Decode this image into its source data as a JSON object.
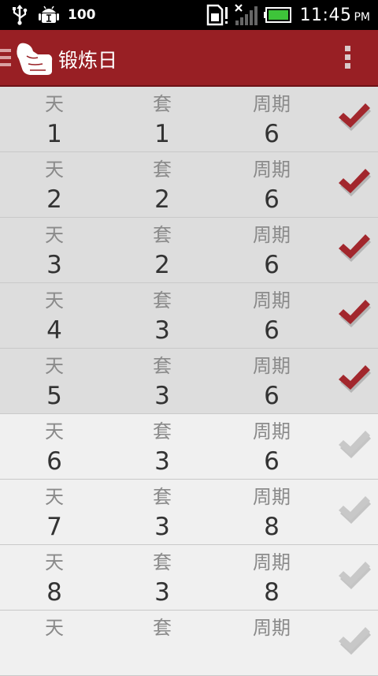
{
  "status_bar": {
    "battery_percent": "100",
    "time": "11:45",
    "ampm": "PM",
    "icons": [
      "usb-icon",
      "android-debug-icon",
      "sim-card-icon",
      "signal-icon",
      "battery-icon"
    ]
  },
  "action_bar": {
    "title": "锻炼日",
    "icons": [
      "up-indicator-icon",
      "app-logo-icon",
      "overflow-menu-icon"
    ]
  },
  "colors": {
    "action_bar": "#981f24",
    "check_done": "#a2272d",
    "check_pending": "#c8c8c8",
    "row_done_bg": "#dddddd",
    "row_todo_bg": "#f0f0f0"
  },
  "list": {
    "headers": [
      "天",
      "套",
      "周期"
    ],
    "rows": [
      {
        "day": "1",
        "sets": "1",
        "cycle": "6",
        "completed": true
      },
      {
        "day": "2",
        "sets": "2",
        "cycle": "6",
        "completed": true
      },
      {
        "day": "3",
        "sets": "2",
        "cycle": "6",
        "completed": true
      },
      {
        "day": "4",
        "sets": "3",
        "cycle": "6",
        "completed": true
      },
      {
        "day": "5",
        "sets": "3",
        "cycle": "6",
        "completed": true
      },
      {
        "day": "6",
        "sets": "3",
        "cycle": "6",
        "completed": false
      },
      {
        "day": "7",
        "sets": "3",
        "cycle": "8",
        "completed": false
      },
      {
        "day": "8",
        "sets": "3",
        "cycle": "8",
        "completed": false
      },
      {
        "day": "",
        "sets": "",
        "cycle": "",
        "completed": false
      }
    ]
  }
}
